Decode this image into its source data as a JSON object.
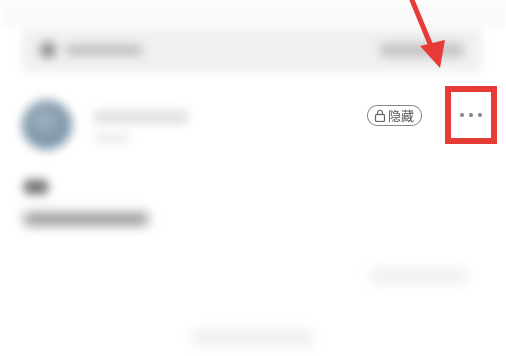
{
  "post": {
    "visibility_badge": "隐藏"
  },
  "colors": {
    "highlight": "#e63b36",
    "badge_border": "#888888",
    "badge_text": "#555555"
  },
  "icons": {
    "lock": "lock-icon",
    "more": "more-options-icon",
    "search": "search-icon"
  }
}
